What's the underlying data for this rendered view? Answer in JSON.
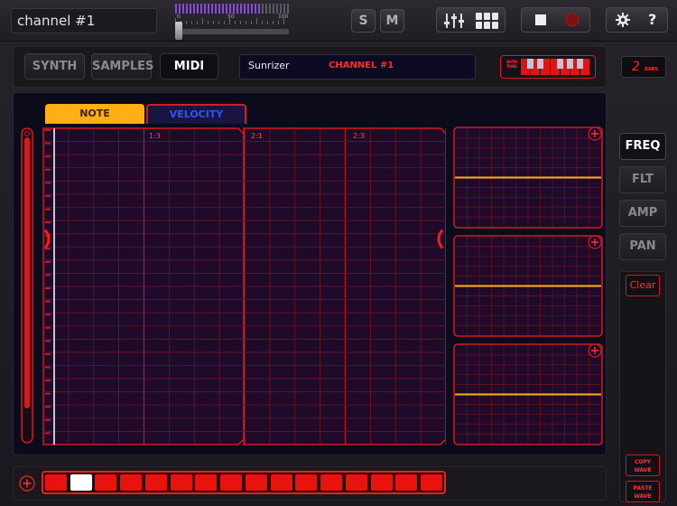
{
  "header": {
    "channel_name": "channel #1",
    "meter_ticks": [
      "0",
      "50",
      "100"
    ],
    "solo_label": "S",
    "mute_label": "M",
    "help_label": "?"
  },
  "icons": {
    "mixer": "mixer-icon",
    "grid": "grid-icon",
    "stop": "stop-icon",
    "record": "record-icon",
    "settings": "gear-icon"
  },
  "module_tabs": [
    {
      "label": "SYNTH",
      "active": false
    },
    {
      "label": "SAMPLES",
      "active": false
    },
    {
      "label": "MIDI",
      "active": true
    }
  ],
  "instrument": {
    "name": "Sunrizer",
    "channel": "CHANNEL #1"
  },
  "keyboard": {
    "label": "AUTO TUNE"
  },
  "bars": {
    "value": "2",
    "unit": "BARS"
  },
  "editor": {
    "tabs": {
      "note": "NOTE",
      "velocity": "VELOCITY"
    },
    "active_tab": "NOTE",
    "position_markers": [
      "1:3",
      "2:1",
      "2:3"
    ],
    "note_level": 0.65
  },
  "lfo_panels": [
    {
      "level": 0.5
    },
    {
      "level": 0.5
    },
    {
      "level": 0.5
    }
  ],
  "side": {
    "buttons": [
      {
        "label": "FREQ",
        "active": true
      },
      {
        "label": "FLT",
        "active": false
      },
      {
        "label": "AMP",
        "active": false
      },
      {
        "label": "PAN",
        "active": false
      }
    ],
    "clear_label": "Clear",
    "copy_label": "COPY WAVE",
    "paste_label": "PASTE WAVE"
  },
  "steps": {
    "count": 16,
    "selected_index": 1
  },
  "colors": {
    "accent": "#ff2020",
    "note_tab": "#ffae14",
    "velocity_text": "#2a55ff",
    "note_line": "#ffb020"
  }
}
